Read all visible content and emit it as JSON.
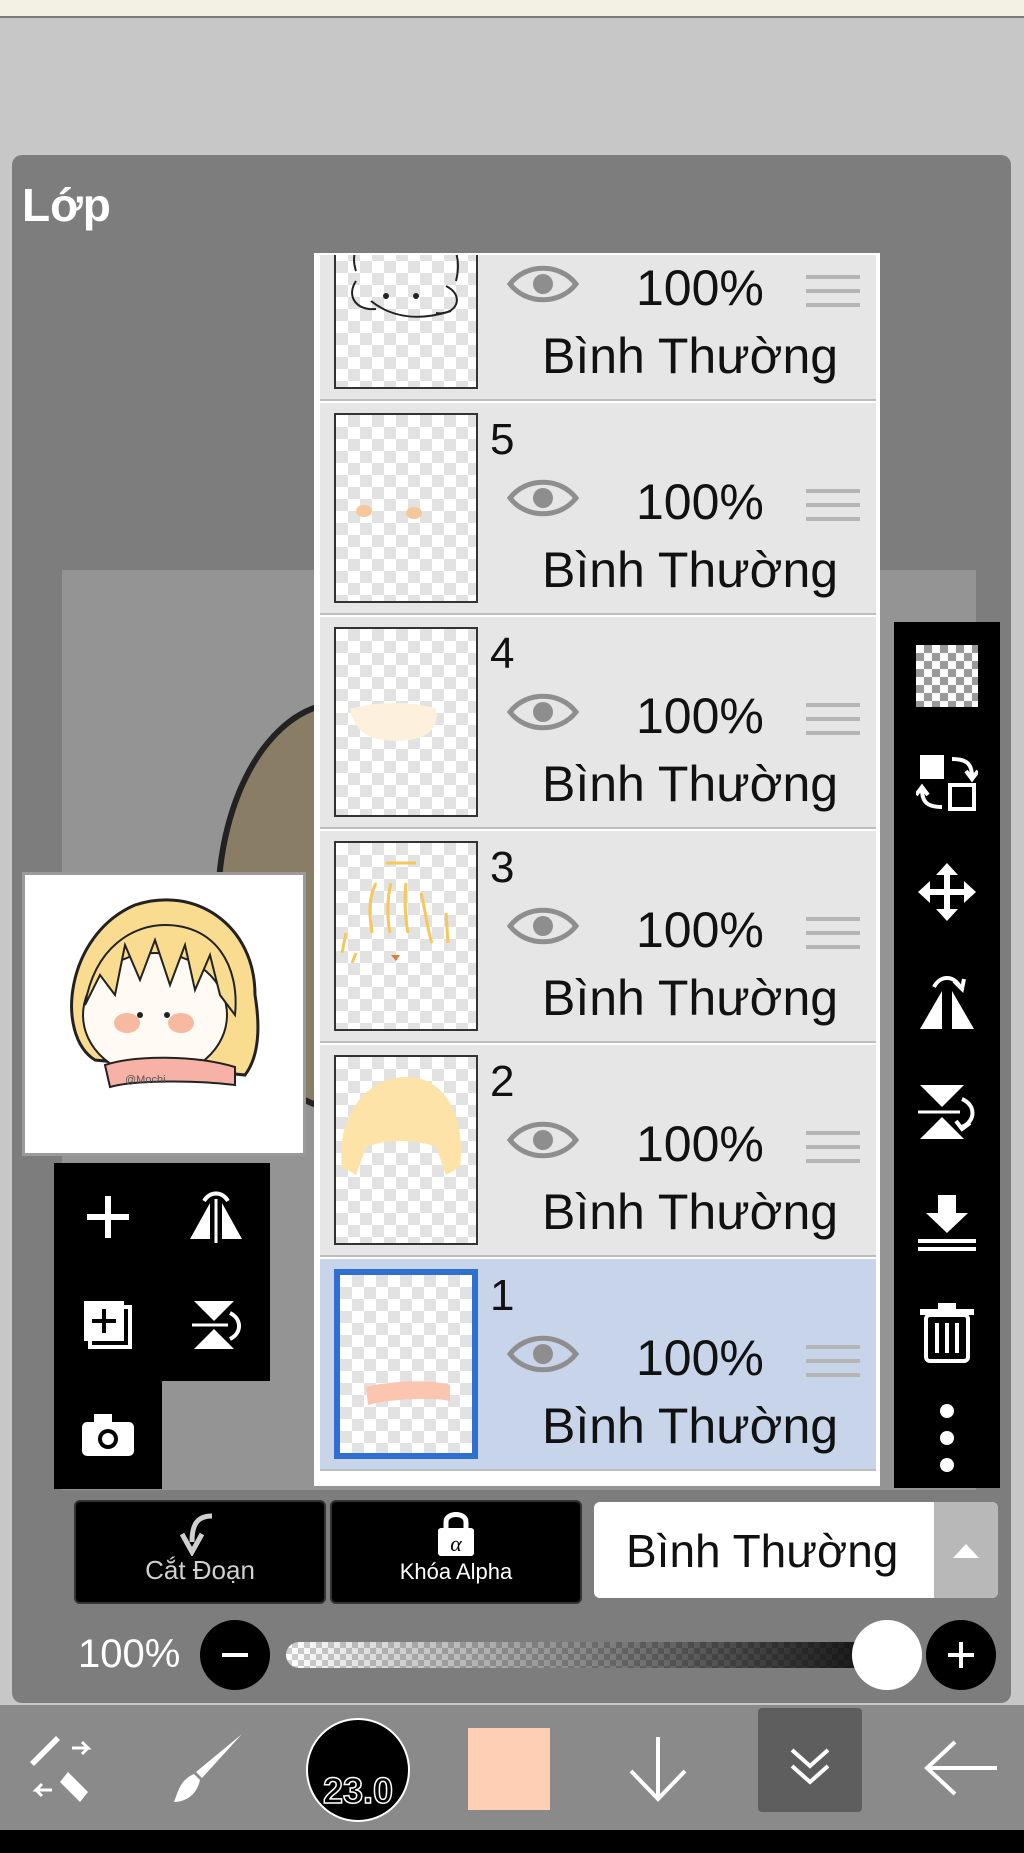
{
  "title": "Lớp",
  "layers": [
    {
      "name": "",
      "opacity": "100%",
      "blend": "Bình Thường",
      "selected": false
    },
    {
      "name": "5",
      "opacity": "100%",
      "blend": "Bình Thường",
      "selected": false
    },
    {
      "name": "4",
      "opacity": "100%",
      "blend": "Bình Thường",
      "selected": false
    },
    {
      "name": "3",
      "opacity": "100%",
      "blend": "Bình Thường",
      "selected": false
    },
    {
      "name": "2",
      "opacity": "100%",
      "blend": "Bình Thường",
      "selected": false
    },
    {
      "name": "1",
      "opacity": "100%",
      "blend": "Bình Thường",
      "selected": true
    }
  ],
  "controls": {
    "clipping_label": "Cắt Đoạn",
    "alpha_lock_label": "Khóa Alpha",
    "blend_mode": "Bình Thường",
    "opacity_label": "100%",
    "opacity_value": 1.0
  },
  "toolbar": {
    "brush_size": "23.0",
    "color": "#ffcfb5"
  },
  "preview": {
    "signature": "@Mochi"
  },
  "colors": {
    "panel": "#7d7d7d",
    "selected_layer": "#c7d4ea",
    "selected_border": "#2e6fd0"
  }
}
